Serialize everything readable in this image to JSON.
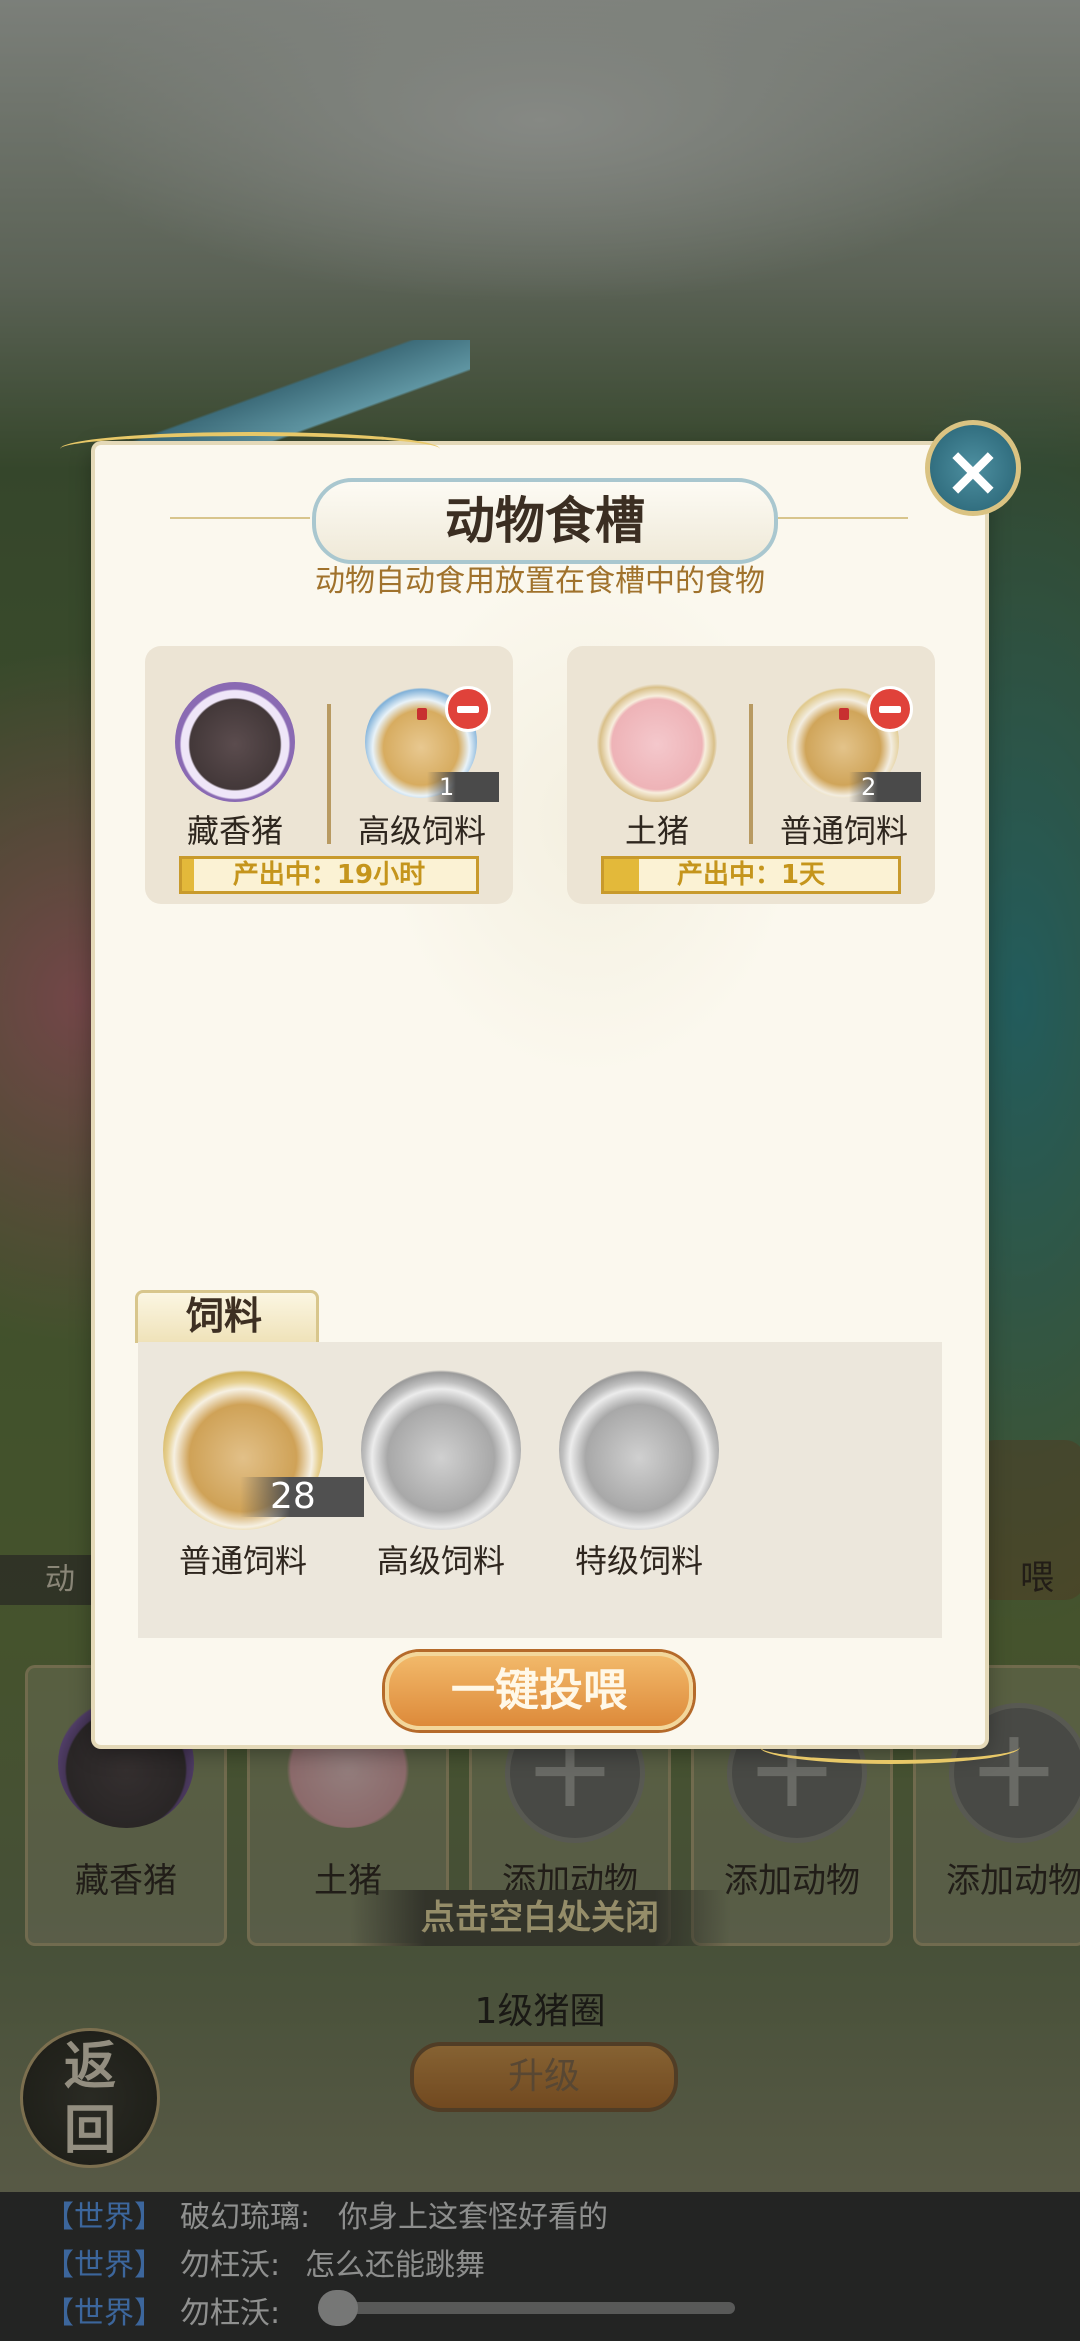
{
  "popup": {
    "title": "动物食槽",
    "subtitle": "动物自动食用放置在食槽中的食物",
    "close_icon": "×",
    "troughs": [
      {
        "animal": "藏香猪",
        "feed": "高级饲料",
        "feed_count": "1",
        "status": "产出中：19小时",
        "progress": 0.04
      },
      {
        "animal": "土猪",
        "feed": "普通饲料",
        "feed_count": "2",
        "status": "产出中：1天",
        "progress": 0.12
      }
    ],
    "feed_section": {
      "tab_label": "饲料",
      "items": [
        {
          "name": "普通饲料",
          "count": "28",
          "available": true
        },
        {
          "name": "高级饲料",
          "count": "",
          "available": false
        },
        {
          "name": "特级饲料",
          "count": "",
          "available": false
        }
      ]
    },
    "feed_all_button": "一键投喂"
  },
  "background": {
    "slots": [
      "藏香猪",
      "土猪",
      "添加动物",
      "添加动物",
      "添加动物"
    ],
    "hint": "点击空白处关闭",
    "pen_level": "1级猪圈",
    "upgrade_button": "升级",
    "back_button_line1": "返",
    "back_button_line2": "回",
    "side_tab": "动",
    "side_right": "喂"
  },
  "chat": [
    {
      "channel": "【世界】",
      "user": "破幻琉璃:",
      "text": "你身上这套怪好看的"
    },
    {
      "channel": "【世界】",
      "user": "勿枉沃:",
      "text": "怎么还能跳舞"
    },
    {
      "channel": "【世界】",
      "user": "勿枉沃:",
      "text": ""
    }
  ],
  "colors": {
    "accent_gold": "#e3b93a",
    "minus_red": "#e0423a",
    "button_orange": "#dd8a3a",
    "chat_channel": "#5aa0ff"
  }
}
